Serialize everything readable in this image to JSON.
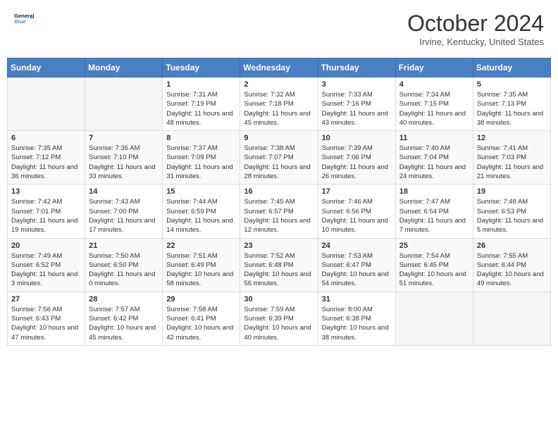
{
  "header": {
    "logo_line1": "General",
    "logo_line2": "Blue",
    "month_title": "October 2024",
    "location": "Irvine, Kentucky, United States"
  },
  "weekdays": [
    "Sunday",
    "Monday",
    "Tuesday",
    "Wednesday",
    "Thursday",
    "Friday",
    "Saturday"
  ],
  "weeks": [
    [
      {
        "day": "",
        "sunrise": "",
        "sunset": "",
        "daylight": ""
      },
      {
        "day": "",
        "sunrise": "",
        "sunset": "",
        "daylight": ""
      },
      {
        "day": "1",
        "sunrise": "Sunrise: 7:31 AM",
        "sunset": "Sunset: 7:19 PM",
        "daylight": "Daylight: 11 hours and 48 minutes."
      },
      {
        "day": "2",
        "sunrise": "Sunrise: 7:32 AM",
        "sunset": "Sunset: 7:18 PM",
        "daylight": "Daylight: 11 hours and 45 minutes."
      },
      {
        "day": "3",
        "sunrise": "Sunrise: 7:33 AM",
        "sunset": "Sunset: 7:16 PM",
        "daylight": "Daylight: 11 hours and 43 minutes."
      },
      {
        "day": "4",
        "sunrise": "Sunrise: 7:34 AM",
        "sunset": "Sunset: 7:15 PM",
        "daylight": "Daylight: 11 hours and 40 minutes."
      },
      {
        "day": "5",
        "sunrise": "Sunrise: 7:35 AM",
        "sunset": "Sunset: 7:13 PM",
        "daylight": "Daylight: 11 hours and 38 minutes."
      }
    ],
    [
      {
        "day": "6",
        "sunrise": "Sunrise: 7:35 AM",
        "sunset": "Sunset: 7:12 PM",
        "daylight": "Daylight: 11 hours and 36 minutes."
      },
      {
        "day": "7",
        "sunrise": "Sunrise: 7:36 AM",
        "sunset": "Sunset: 7:10 PM",
        "daylight": "Daylight: 11 hours and 33 minutes."
      },
      {
        "day": "8",
        "sunrise": "Sunrise: 7:37 AM",
        "sunset": "Sunset: 7:09 PM",
        "daylight": "Daylight: 11 hours and 31 minutes."
      },
      {
        "day": "9",
        "sunrise": "Sunrise: 7:38 AM",
        "sunset": "Sunset: 7:07 PM",
        "daylight": "Daylight: 11 hours and 28 minutes."
      },
      {
        "day": "10",
        "sunrise": "Sunrise: 7:39 AM",
        "sunset": "Sunset: 7:06 PM",
        "daylight": "Daylight: 11 hours and 26 minutes."
      },
      {
        "day": "11",
        "sunrise": "Sunrise: 7:40 AM",
        "sunset": "Sunset: 7:04 PM",
        "daylight": "Daylight: 11 hours and 24 minutes."
      },
      {
        "day": "12",
        "sunrise": "Sunrise: 7:41 AM",
        "sunset": "Sunset: 7:03 PM",
        "daylight": "Daylight: 11 hours and 21 minutes."
      }
    ],
    [
      {
        "day": "13",
        "sunrise": "Sunrise: 7:42 AM",
        "sunset": "Sunset: 7:01 PM",
        "daylight": "Daylight: 11 hours and 19 minutes."
      },
      {
        "day": "14",
        "sunrise": "Sunrise: 7:43 AM",
        "sunset": "Sunset: 7:00 PM",
        "daylight": "Daylight: 11 hours and 17 minutes."
      },
      {
        "day": "15",
        "sunrise": "Sunrise: 7:44 AM",
        "sunset": "Sunset: 6:59 PM",
        "daylight": "Daylight: 11 hours and 14 minutes."
      },
      {
        "day": "16",
        "sunrise": "Sunrise: 7:45 AM",
        "sunset": "Sunset: 6:57 PM",
        "daylight": "Daylight: 11 hours and 12 minutes."
      },
      {
        "day": "17",
        "sunrise": "Sunrise: 7:46 AM",
        "sunset": "Sunset: 6:56 PM",
        "daylight": "Daylight: 11 hours and 10 minutes."
      },
      {
        "day": "18",
        "sunrise": "Sunrise: 7:47 AM",
        "sunset": "Sunset: 6:54 PM",
        "daylight": "Daylight: 11 hours and 7 minutes."
      },
      {
        "day": "19",
        "sunrise": "Sunrise: 7:48 AM",
        "sunset": "Sunset: 6:53 PM",
        "daylight": "Daylight: 11 hours and 5 minutes."
      }
    ],
    [
      {
        "day": "20",
        "sunrise": "Sunrise: 7:49 AM",
        "sunset": "Sunset: 6:52 PM",
        "daylight": "Daylight: 11 hours and 3 minutes."
      },
      {
        "day": "21",
        "sunrise": "Sunrise: 7:50 AM",
        "sunset": "Sunset: 6:50 PM",
        "daylight": "Daylight: 11 hours and 0 minutes."
      },
      {
        "day": "22",
        "sunrise": "Sunrise: 7:51 AM",
        "sunset": "Sunset: 6:49 PM",
        "daylight": "Daylight: 10 hours and 58 minutes."
      },
      {
        "day": "23",
        "sunrise": "Sunrise: 7:52 AM",
        "sunset": "Sunset: 6:48 PM",
        "daylight": "Daylight: 10 hours and 56 minutes."
      },
      {
        "day": "24",
        "sunrise": "Sunrise: 7:53 AM",
        "sunset": "Sunset: 6:47 PM",
        "daylight": "Daylight: 10 hours and 54 minutes."
      },
      {
        "day": "25",
        "sunrise": "Sunrise: 7:54 AM",
        "sunset": "Sunset: 6:45 PM",
        "daylight": "Daylight: 10 hours and 51 minutes."
      },
      {
        "day": "26",
        "sunrise": "Sunrise: 7:55 AM",
        "sunset": "Sunset: 6:44 PM",
        "daylight": "Daylight: 10 hours and 49 minutes."
      }
    ],
    [
      {
        "day": "27",
        "sunrise": "Sunrise: 7:56 AM",
        "sunset": "Sunset: 6:43 PM",
        "daylight": "Daylight: 10 hours and 47 minutes."
      },
      {
        "day": "28",
        "sunrise": "Sunrise: 7:57 AM",
        "sunset": "Sunset: 6:42 PM",
        "daylight": "Daylight: 10 hours and 45 minutes."
      },
      {
        "day": "29",
        "sunrise": "Sunrise: 7:58 AM",
        "sunset": "Sunset: 6:41 PM",
        "daylight": "Daylight: 10 hours and 42 minutes."
      },
      {
        "day": "30",
        "sunrise": "Sunrise: 7:59 AM",
        "sunset": "Sunset: 6:39 PM",
        "daylight": "Daylight: 10 hours and 40 minutes."
      },
      {
        "day": "31",
        "sunrise": "Sunrise: 8:00 AM",
        "sunset": "Sunset: 6:38 PM",
        "daylight": "Daylight: 10 hours and 38 minutes."
      },
      {
        "day": "",
        "sunrise": "",
        "sunset": "",
        "daylight": ""
      },
      {
        "day": "",
        "sunrise": "",
        "sunset": "",
        "daylight": ""
      }
    ]
  ]
}
